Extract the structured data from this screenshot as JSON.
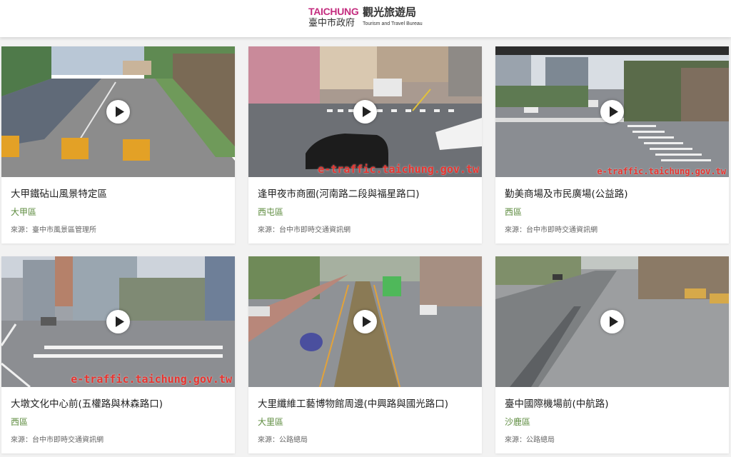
{
  "header": {
    "logo_brand": "TAICHUNG",
    "logo_bureau": "觀光旅遊局",
    "logo_city": "臺中市政府",
    "logo_english": "Tourism and Travel Bureau"
  },
  "cameras": [
    {
      "title": "大甲鐵砧山風景特定區",
      "district": "大甲區",
      "source": "來源：臺中市風景區管理所",
      "watermark": ""
    },
    {
      "title": "逢甲夜市商圈(河南路二段與福星路口)",
      "district": "西屯區",
      "source": "來源：台中市即時交通資訊網",
      "watermark": "e-traffic.taichung.gov.tw"
    },
    {
      "title": "勤美商場及市民廣場(公益路)",
      "district": "西區",
      "source": "來源：台中市即時交通資訊網",
      "watermark": "e-traffic.taichung.gov.tw"
    },
    {
      "title": "大墩文化中心前(五權路與林森路口)",
      "district": "西區",
      "source": "來源：台中市即時交通資訊網",
      "watermark": "e-traffic.taichung.gov.tw"
    },
    {
      "title": "大里纖維工藝博物館周邊(中興路與國光路口)",
      "district": "大里區",
      "source": "來源：公路總局",
      "watermark": ""
    },
    {
      "title": "臺中國際機場前(中航路)",
      "district": "沙鹿區",
      "source": "來源：公路總局",
      "watermark": ""
    }
  ],
  "colors": {
    "brand": "#c42d7f",
    "district": "#5b8a3c",
    "watermark": "#e8342f"
  },
  "icons": {
    "play": "play-icon"
  }
}
